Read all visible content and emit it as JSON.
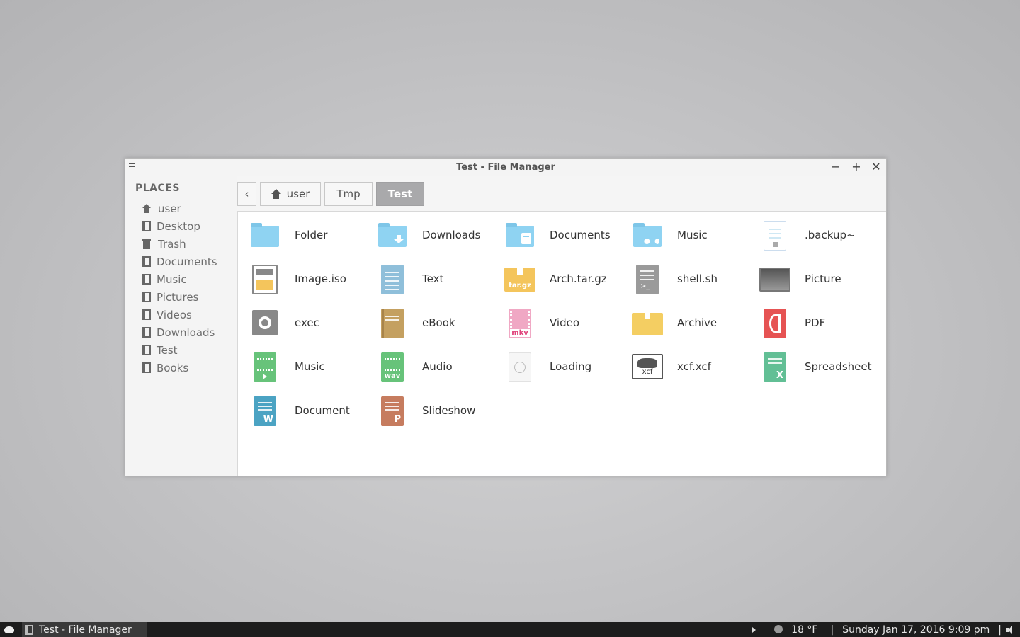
{
  "window": {
    "title": "Test - File Manager",
    "minimize": "−",
    "maximize": "+",
    "close": "✕"
  },
  "sidebar": {
    "title": "PLACES",
    "items": [
      {
        "label": "user",
        "icon": "home-icon"
      },
      {
        "label": "Desktop",
        "icon": "folder-bookmark-icon"
      },
      {
        "label": "Trash",
        "icon": "trash-icon"
      },
      {
        "label": "Documents",
        "icon": "folder-bookmark-icon"
      },
      {
        "label": "Music",
        "icon": "folder-bookmark-icon"
      },
      {
        "label": "Pictures",
        "icon": "folder-bookmark-icon"
      },
      {
        "label": "Videos",
        "icon": "folder-bookmark-icon"
      },
      {
        "label": "Downloads",
        "icon": "folder-bookmark-icon"
      },
      {
        "label": "Test",
        "icon": "folder-bookmark-icon"
      },
      {
        "label": "Books",
        "icon": "folder-bookmark-icon"
      }
    ]
  },
  "pathbar": {
    "back": "‹",
    "crumbs": [
      "user",
      "Tmp",
      "Test"
    ]
  },
  "files": [
    {
      "label": "Folder",
      "icon": "folder-icon"
    },
    {
      "label": "Downloads",
      "icon": "downloads-folder-icon"
    },
    {
      "label": "Documents",
      "icon": "documents-folder-icon"
    },
    {
      "label": "Music",
      "icon": "music-folder-icon"
    },
    {
      "label": ".backup~",
      "icon": "backup-file-icon"
    },
    {
      "label": "Image.iso",
      "icon": "disc-image-icon"
    },
    {
      "label": "Text",
      "icon": "text-file-icon"
    },
    {
      "label": "Arch.tar.gz",
      "icon": "tar-archive-icon",
      "tag": "tar.gz"
    },
    {
      "label": "shell.sh",
      "icon": "shell-script-icon"
    },
    {
      "label": "Picture",
      "icon": "picture-file-icon"
    },
    {
      "label": "exec",
      "icon": "executable-icon"
    },
    {
      "label": "eBook",
      "icon": "ebook-icon"
    },
    {
      "label": "Video",
      "icon": "video-file-icon",
      "tag": "mkv"
    },
    {
      "label": "Archive",
      "icon": "archive-box-icon"
    },
    {
      "label": "PDF",
      "icon": "pdf-file-icon"
    },
    {
      "label": "Music",
      "icon": "music-file-icon"
    },
    {
      "label": "Audio",
      "icon": "audio-file-icon",
      "tag": "wav"
    },
    {
      "label": "Loading",
      "icon": "loading-icon"
    },
    {
      "label": "xcf.xcf",
      "icon": "gimp-xcf-icon",
      "tag": "xcf"
    },
    {
      "label": "Spreadsheet",
      "icon": "spreadsheet-icon"
    },
    {
      "label": "Document",
      "icon": "word-document-icon"
    },
    {
      "label": "Slideshow",
      "icon": "presentation-icon"
    }
  ],
  "taskbar": {
    "task": "Test - File Manager",
    "weather": "18 °F",
    "sep1": "|",
    "datetime": "Sunday Jan 17, 2016  9:09 pm",
    "sep2": "|"
  },
  "colors": {
    "folder": "#8fd3f2",
    "active_crumb": "#a9a9ab",
    "taskbar": "#1d1d1d"
  }
}
